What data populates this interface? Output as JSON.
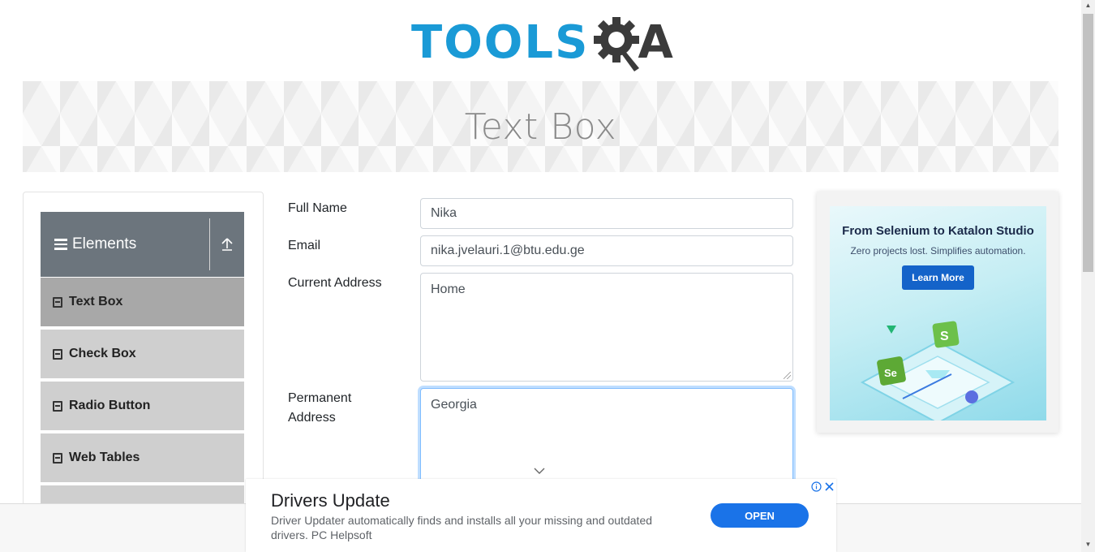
{
  "header": {
    "logo_part1": "TOOLS",
    "logo_part2": "A",
    "banner_title": "Text Box"
  },
  "sidebar": {
    "group_title": "Elements",
    "items": [
      {
        "label": "Text Box",
        "active": true
      },
      {
        "label": "Check Box",
        "active": false
      },
      {
        "label": "Radio Button",
        "active": false
      },
      {
        "label": "Web Tables",
        "active": false
      }
    ]
  },
  "form": {
    "full_name": {
      "label": "Full Name",
      "value": "Nika"
    },
    "email": {
      "label": "Email",
      "value": "nika.jvelauri.1@btu.edu.ge"
    },
    "current_address": {
      "label": "Current Address",
      "value": "Home"
    },
    "permanent_address": {
      "label": "Permanent Address",
      "value": "Georgia"
    }
  },
  "side_ad": {
    "headline": "From Selenium to Katalon Studio",
    "subline": "Zero projects lost. Simplifies automation.",
    "button": "Learn More"
  },
  "bottom_ad": {
    "title": "Drivers Update",
    "description": "Driver Updater automatically finds and installs all your missing and outdated drivers. PC Helpsoft",
    "button": "OPEN",
    "info_icon": "info-icon",
    "close_icon": "close-icon"
  },
  "colors": {
    "brand_blue": "#1a9ad6",
    "sidebar_header": "#6c757d",
    "menu_item": "#cfcfcf",
    "menu_item_active": "#a8a8a8",
    "ad_button": "#1a73e8"
  }
}
